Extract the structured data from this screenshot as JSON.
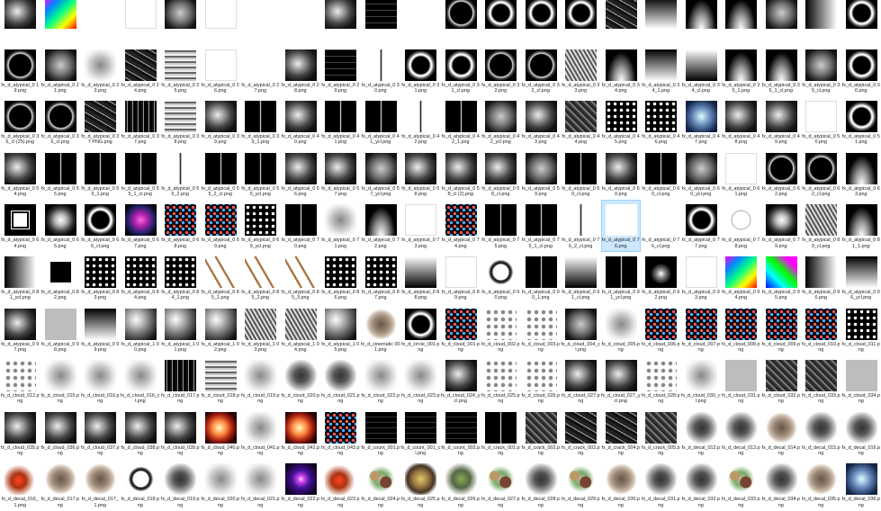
{
  "rows": [
    [
      [
        "",
        "p-cloud"
      ],
      [
        "",
        "p-rainb"
      ],
      [
        "",
        "p-white"
      ],
      [
        "",
        "p-whiteB"
      ],
      [
        "",
        "p-soft"
      ],
      [
        "",
        "p-whiteB"
      ],
      [
        "",
        "p-white"
      ],
      [
        "",
        "p-white"
      ],
      [
        "",
        "p-cloud"
      ],
      [
        "",
        "p-grid"
      ],
      [
        "",
        "p-white"
      ],
      [
        "",
        "p-ring2"
      ],
      [
        "",
        "p-ring"
      ],
      [
        "",
        "p-ring"
      ],
      [
        "",
        "p-ring"
      ],
      [
        "",
        "p-streak"
      ],
      [
        "",
        "p-vgrad"
      ],
      [
        "",
        "p-cone"
      ],
      [
        "",
        "p-cone"
      ],
      [
        "",
        "p-soft"
      ],
      [
        "",
        "p-hgrad"
      ],
      [
        "",
        "p-ring"
      ]
    ],
    [
      [
        "fx_d_atypical_0 19.png",
        "p-ring2"
      ],
      [
        "fx_d_atypical_0 21.png",
        "p-soft"
      ],
      [
        "fx_d_atypical_0 23.png",
        "p-cloudW"
      ],
      [
        "fx_d_atypical_0 24.png",
        "p-streak"
      ],
      [
        "fx_d_atypical_0 25.png",
        "p-wave"
      ],
      [
        "fx_d_atypical_0 26.png",
        "p-whiteB"
      ],
      [
        "fx_d_atypical_0 27.png",
        "p-white"
      ],
      [
        "fx_d_atypical_0 28.png",
        "p-cloud"
      ],
      [
        "fx_d_atypical_0 29.png",
        "p-grid"
      ],
      [
        "fx_d_atypical_0 30.png",
        "p-lineW"
      ],
      [
        "fx_d_atypical_0 31.png",
        "p-ring"
      ],
      [
        "fx_d_atypical_0 31_cl.png",
        "p-ring"
      ],
      [
        "fx_d_atypical_0 32.png",
        "p-ring2"
      ],
      [
        "fx_d_atypical_0 32_cl.png",
        "p-ring2"
      ],
      [
        "fx_d_atypical_0 33.png",
        "p-lattice"
      ],
      [
        "fx_d_atypical_0 34.png",
        "p-cone"
      ],
      [
        "fx_d_atypical_0 34_1.png",
        "p-vgrad"
      ],
      [
        "fx_d_atypical_0 34_cl.png",
        "p-vgradR"
      ],
      [
        "fx_d_atypical_0 35_1.png",
        "p-cone"
      ],
      [
        "fx_d_atypical_0 35_1_cl.png",
        "p-cone"
      ],
      [
        "fx_d_atypical_0 35_cl.png",
        "p-soft"
      ],
      [
        "fx_d_atypical_0 36.png",
        "p-ring"
      ]
    ],
    [
      [
        "fx_d_atypical_0 36_cl (25).png",
        "p-ring2"
      ],
      [
        "fx_d_atypical_0 36_cl.png",
        "p-ring2"
      ],
      [
        "fx_d_atypical_0 37 PNG.png",
        "p-streak"
      ],
      [
        "fx_d_atypical_0 37.png",
        "p-strkV"
      ],
      [
        "fx_d_atypical_0 38.png",
        "p-wave"
      ],
      [
        "fx_d_atypical_0 39.png",
        "p-cloud"
      ],
      [
        "fx_d_atypical_0 39_1.png",
        "p-line"
      ],
      [
        "fx_d_atypical_0 40.png",
        "p-cloud"
      ],
      [
        "fx_d_atypical_0 41.png",
        "p-line"
      ],
      [
        "fx_d_atypical_0 41_ycl.png",
        "p-line"
      ],
      [
        "fx_d_atypical_0 42.png",
        "p-lineW"
      ],
      [
        "fx_d_atypical_0 42_1.png",
        "p-line"
      ],
      [
        "fx_d_atypical_0 42_ycl.png",
        "p-soft"
      ],
      [
        "fx_d_atypical_0 43.png",
        "p-cloud"
      ],
      [
        "fx_d_atypical_0 44.png",
        "p-noise"
      ],
      [
        "fx_d_atypical_0 45.png",
        "p-dots"
      ],
      [
        "fx_d_atypical_0 46.png",
        "p-dots"
      ],
      [
        "fx_d_atypical_0 47.png",
        "p-blue"
      ],
      [
        "fx_d_atypical_0 48.png",
        "p-cloud"
      ],
      [
        "fx_d_atypical_0 49.png",
        "p-cloud"
      ],
      [
        "fx_d_atypical_0 50.png",
        "p-whiteB"
      ],
      [
        "fx_d_atypical_0 51.png",
        "p-ring"
      ]
    ],
    [
      [
        "fx_d_atypical_0 54.png",
        "p-cloud"
      ],
      [
        "fx_d_atypical_0 55.png",
        "p-line"
      ],
      [
        "fx_d_atypical_0 55_1.png",
        "p-line"
      ],
      [
        "fx_d_atypical_0 55_1_cl.png",
        "p-line"
      ],
      [
        "fx_d_atypical_0 55_2.png",
        "p-lineW"
      ],
      [
        "fx_d_atypical_0 55_2_cl.png",
        "p-line"
      ],
      [
        "fx_d_atypical_0 55_ycl.png",
        "p-line"
      ],
      [
        "fx_d_atypical_0 56.png",
        "p-cloud"
      ],
      [
        "fx_d_atypical_0 57.png",
        "p-cloud"
      ],
      [
        "fx_d_atypical_0 57_ycl.png",
        "p-soft"
      ],
      [
        "fx_d_atypical_0 58.png",
        "p-cloud"
      ],
      [
        "fx_d_atypical_0 58_cl (2).png",
        "p-cloud"
      ],
      [
        "fx_d_atypical_0 58_cl.png",
        "p-cloud"
      ],
      [
        "fx_d_atypical_0 59.png",
        "p-soft"
      ],
      [
        "fx_d_atypical_0 59_cl.png",
        "p-line"
      ],
      [
        "fx_d_atypical_0 60.png",
        "p-cloud"
      ],
      [
        "fx_d_atypical_0 60_cl.png",
        "p-line"
      ],
      [
        "fx_d_atypical_0 60_ycl.png",
        "p-soft"
      ],
      [
        "fx_d_atypical_0 61.png",
        "p-whiteB"
      ],
      [
        "fx_d_atypical_0 62.png",
        "p-ring2"
      ],
      [
        "fx_d_atypical_0 62_cl.png",
        "p-ring2"
      ],
      [
        "fx_d_atypical_0 63.png",
        "p-cone"
      ]
    ],
    [
      [
        "fx_d_atypical_0 64.png",
        "p-sqOut"
      ],
      [
        "fx_d_atypical_0 65.png",
        "p-glow"
      ],
      [
        "fx_d_atypical_0 66_cl.png",
        "p-ring"
      ],
      [
        "fx_d_atypical_0 67.png",
        "p-neon"
      ],
      [
        "fx_d_atypical_0 68.png",
        "p-dotsC"
      ],
      [
        "fx_d_atypical_0 69.png",
        "p-dotsC"
      ],
      [
        "fx_d_atypical_0 69_ycl.png",
        "p-dots"
      ],
      [
        "fx_d_atypical_0 70.png",
        "p-line"
      ],
      [
        "fx_d_atypical_0 71.png",
        "p-cloudW"
      ],
      [
        "fx_d_atypical_0 72.png",
        "p-cone"
      ],
      [
        "fx_d_atypical_0 73.png",
        "p-whiteB"
      ],
      [
        "fx_d_atypical_0 74.png",
        "p-dotsC"
      ],
      [
        "fx_d_atypical_0 75.png",
        "p-line"
      ],
      [
        "fx_d_atypical_0 75_1_cl.png",
        "p-line"
      ],
      [
        "fx_d_atypical_0 76_2_cl.png",
        "p-lineW"
      ],
      [
        "fx_d_atypical_0 76.png",
        "p-white"
      ],
      [
        "fx_d_atypical_0 76_cl.png",
        "p-white"
      ],
      [
        "fx_d_atypical_0 77.png",
        "p-ring"
      ],
      [
        "fx_d_atypical_0 78.png",
        "p-bubble"
      ],
      [
        "fx_d_atypical_0 79.png",
        "p-glow"
      ],
      [
        "fx_d_atypical_0 80_cl.png",
        "p-lattice"
      ],
      [
        "fx_d_atypical_0 81_1.png",
        "p-cone"
      ]
    ],
    [
      [
        "fx_d_atypical_0 81_ycl.png",
        "p-hgrad"
      ],
      [
        "fx_d_atypical_0 82.png",
        "p-square"
      ],
      [
        "fx_d_atypical_0 83.png",
        "p-dots"
      ],
      [
        "fx_d_atypical_0 84.png",
        "p-dots"
      ],
      [
        "fx_d_atypical_0 84_1.png",
        "p-dots"
      ],
      [
        "fx_d_atypical_0 85_1.png",
        "p-feather"
      ],
      [
        "fx_d_atypical_0 85_2.png",
        "p-feather"
      ],
      [
        "fx_d_atypical_0 85_3.png",
        "p-feather"
      ],
      [
        "fx_d_atypical_0 86.png",
        "p-dots"
      ],
      [
        "fx_d_atypical_0 87.png",
        "p-dots"
      ],
      [
        "fx_d_atypical_0 88.png",
        "p-vgradR"
      ],
      [
        "fx_d_atypical_0 89.png",
        "p-whiteB"
      ],
      [
        "fx_d_atypical_0 90.png",
        "p-ringD"
      ],
      [
        "fx_d_atypical_0 90_1.png",
        "p-line"
      ],
      [
        "fx_d_atypical_0 91_cl.png",
        "p-vgradR"
      ],
      [
        "fx_d_atypical_0 91_ycl.png",
        "p-line"
      ],
      [
        "fx_d_atypical_0 92.png",
        "p-spot"
      ],
      [
        "fx_d_atypical_0 93.png",
        "p-whiteB"
      ],
      [
        "fx_d_atypical_0 94.png",
        "p-rainb"
      ],
      [
        "fx_d_atypical_0 95.png",
        "p-rainb2"
      ],
      [
        "fx_d_atypical_0 96.png",
        "p-hgrad"
      ],
      [
        "fx_d_atypical_0 96_ycl.png",
        "p-vgrad"
      ]
    ],
    [
      [
        "fx_d_atypical_0 97.png",
        "p-cloud"
      ],
      [
        "fx_d_atypical_0 98.png",
        "p-gray"
      ],
      [
        "fx_d_atypical_0 99.png",
        "p-vgrad"
      ],
      [
        "fx_d_atypical_1 00.png",
        "p-sphere"
      ],
      [
        "fx_d_atypical_1 01.png",
        "p-sphere"
      ],
      [
        "fx_d_atypical_1 02.png",
        "p-sphere"
      ],
      [
        "fx_d_atypical_1 03.png",
        "p-lattice"
      ],
      [
        "fx_d_atypical_1 04.png",
        "p-lattice"
      ],
      [
        "fx_d_atypical_1 05.png",
        "p-sphere"
      ],
      [
        "fx_d_cinematic 001.png",
        "p-dirt"
      ],
      [
        "fx_d_circle_001.png",
        "p-ring"
      ],
      [
        "fx_d_cloud_001.png",
        "p-dotsC"
      ],
      [
        "fx_d_cloud_002.png",
        "p-dotsW"
      ],
      [
        "fx_d_cloud_003.png",
        "p-dotsW"
      ],
      [
        "fx_d_cloud_004_cl.png",
        "p-soft"
      ],
      [
        "fx_d_cloud_005.png",
        "p-cloudW"
      ],
      [
        "fx_d_cloud_006.png",
        "p-dotsC"
      ],
      [
        "fx_d_cloud_007.png",
        "p-dotsC"
      ],
      [
        "fx_d_cloud_008.png",
        "p-dotsC"
      ],
      [
        "fx_d_cloud_009.png",
        "p-dotsC"
      ],
      [
        "fx_d_cloud_010.png",
        "p-dotsC"
      ],
      [
        "fx_d_cloud_011.png",
        "p-dots"
      ]
    ],
    [
      [
        "fx_d_cloud_012.png",
        "p-dotsW"
      ],
      [
        "fx_d_cloud_015.png",
        "p-cloudW"
      ],
      [
        "fx_d_cloud_016.png",
        "p-cloudW"
      ],
      [
        "fx_d_cloud_016_cl.png",
        "p-cloudW"
      ],
      [
        "fx_d_cloud_017.png",
        "p-strkV"
      ],
      [
        "fx_d_cloud_018.png",
        "p-wave"
      ],
      [
        "fx_d_cloud_019.png",
        "p-cloudW"
      ],
      [
        "fx_d_cloud_020.png",
        "p-debrisD"
      ],
      [
        "fx_d_cloud_021.png",
        "p-debrisD"
      ],
      [
        "fx_d_cloud_022.png",
        "p-cloudW"
      ],
      [
        "fx_d_cloud_023.png",
        "p-cloudW"
      ],
      [
        "fx_d_cloud_024_ycl.png",
        "p-cloud"
      ],
      [
        "fx_d_cloud_025.png",
        "p-dotsW"
      ],
      [
        "fx_d_cloud_026.png",
        "p-dotsW"
      ],
      [
        "fx_d_cloud_027.png",
        "p-cloud"
      ],
      [
        "fx_d_cloud_027_ycl.png",
        "p-cloud"
      ],
      [
        "fx_d_cloud_028.png",
        "p-dotsW"
      ],
      [
        "fx_d_cloud_030_cl.png",
        "p-cloudW"
      ],
      [
        "fx_d_cloud_031.png",
        "p-gray"
      ],
      [
        "fx_d_cloud_032.png",
        "p-noise"
      ],
      [
        "fx_d_cloud_033.png",
        "p-noise"
      ],
      [
        "fx_d_cloud_034.png",
        "p-gray"
      ]
    ],
    [
      [
        "fx_d_cloud_035.png",
        "p-cloud"
      ],
      [
        "fx_d_cloud_036.png",
        "p-cloud"
      ],
      [
        "fx_d_cloud_037.png",
        "p-cloud"
      ],
      [
        "fx_d_cloud_038.png",
        "p-cloud"
      ],
      [
        "fx_d_cloud_039.png",
        "p-cloud"
      ],
      [
        "fx_d_cloud_040.png",
        "p-fire"
      ],
      [
        "fx_d_cloud_041.png",
        "p-cloudW"
      ],
      [
        "fx_d_cloud_042.png",
        "p-fire"
      ],
      [
        "fx_d_cloud_043.png",
        "p-dotsC"
      ],
      [
        "fx_d_count_001.png",
        "p-numbers"
      ],
      [
        "fx_d_count_001_cl.png",
        "p-numbers"
      ],
      [
        "fx_d_count_002.png",
        "p-numbers"
      ],
      [
        "fx_d_crack_001.png",
        "p-line"
      ],
      [
        "fx_d_crack_002.png",
        "p-noise"
      ],
      [
        "fx_d_crack_003.png",
        "p-streak"
      ],
      [
        "fx_d_crack_004.png",
        "p-streak"
      ],
      [
        "fx_d_crack_005.png",
        "p-noise"
      ],
      [
        "fx_d_decal_012.png",
        "p-debrisD"
      ],
      [
        "fx_d_decal_013.png",
        "p-debrisD"
      ],
      [
        "fx_d_decal_014.png",
        "p-dirt"
      ],
      [
        "fx_d_decal_015.png",
        "p-debrisD"
      ],
      [
        "fx_d_decal_016.png",
        "p-debrisD"
      ]
    ],
    [
      [
        "fx_d_decal_016_1.png",
        "p-red"
      ],
      [
        "fx_d_decal_017.png",
        "p-dirt"
      ],
      [
        "fx_d_decal_017_1.png",
        "p-dirt"
      ],
      [
        "fx_d_decal_018.png",
        "p-ringD"
      ],
      [
        "fx_d_decal_019.png",
        "p-debrisD"
      ],
      [
        "fx_d_decal_020.png",
        "p-cloudW"
      ],
      [
        "fx_d_decal_021.png",
        "p-cloudW"
      ],
      [
        "fx_d_decal_022.png",
        "p-purple"
      ],
      [
        "fx_d_decal_023.png",
        "p-red"
      ],
      [
        "fx_d_decal_024.png",
        "p-debris"
      ],
      [
        "fx_d_decal_025.png",
        "p-gold"
      ],
      [
        "fx_d_decal_026.png",
        "p-green"
      ],
      [
        "fx_d_decal_027.png",
        "p-debris"
      ],
      [
        "fx_d_decal_028.png",
        "p-debrisD"
      ],
      [
        "fx_d_decal_029.png",
        "p-debris"
      ],
      [
        "fx_d_decal_030.png",
        "p-dirt"
      ],
      [
        "fx_d_decal_031.png",
        "p-debrisD"
      ],
      [
        "fx_d_decal_032.png",
        "p-debrisD"
      ],
      [
        "fx_d_decal_033.png",
        "p-debris"
      ],
      [
        "fx_d_decal_034.png",
        "p-debrisD"
      ],
      [
        "fx_d_decal_035.png",
        "p-dirt"
      ],
      [
        "fx_d_decal_036.png",
        "p-blue"
      ]
    ]
  ],
  "selected": {
    "row": 4,
    "col": 15
  }
}
